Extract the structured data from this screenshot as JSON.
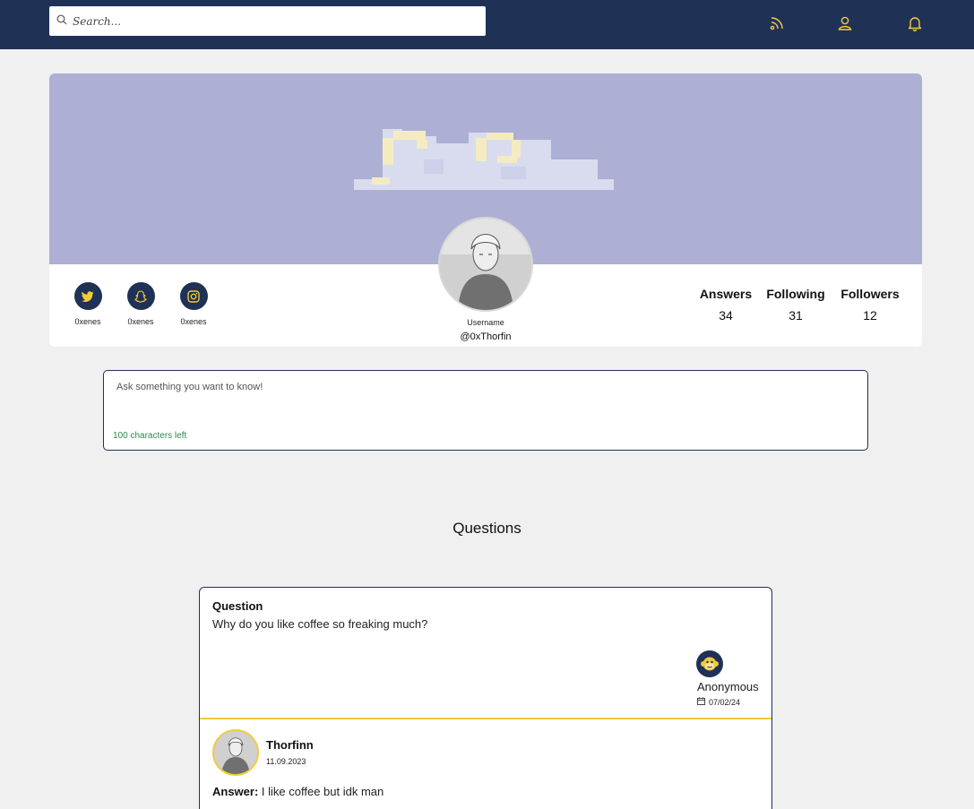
{
  "header": {
    "search_placeholder": "Search...",
    "icons": [
      "rss-feed-icon",
      "user-icon",
      "bell-icon"
    ],
    "accent_color": "#f2cb3a",
    "bg_color": "#1f3155"
  },
  "profile": {
    "username_label": "Username",
    "handle": "@0xThorfin",
    "socials": [
      {
        "icon": "twitter-icon",
        "handle": "0xenes"
      },
      {
        "icon": "snapchat-icon",
        "handle": "0xenes"
      },
      {
        "icon": "instagram-icon",
        "handle": "0xenes"
      }
    ],
    "stats": [
      {
        "label": "Answers",
        "value": "34"
      },
      {
        "label": "Following",
        "value": "31"
      },
      {
        "label": "Followers",
        "value": "12"
      }
    ]
  },
  "ask": {
    "placeholder": "Ask something you want to know!",
    "chars_left": "100 characters left"
  },
  "questions_title": "Questions",
  "question": {
    "heading": "Question",
    "text": "Why do you like coffee so freaking much?",
    "asker_name": "Anonymous",
    "asker_date": "07/02/24",
    "answerer_name": "Thorfinn",
    "answer_date": "11.09.2023",
    "answer_label": "Answer:",
    "answer_text": "I like coffee but idk man"
  }
}
